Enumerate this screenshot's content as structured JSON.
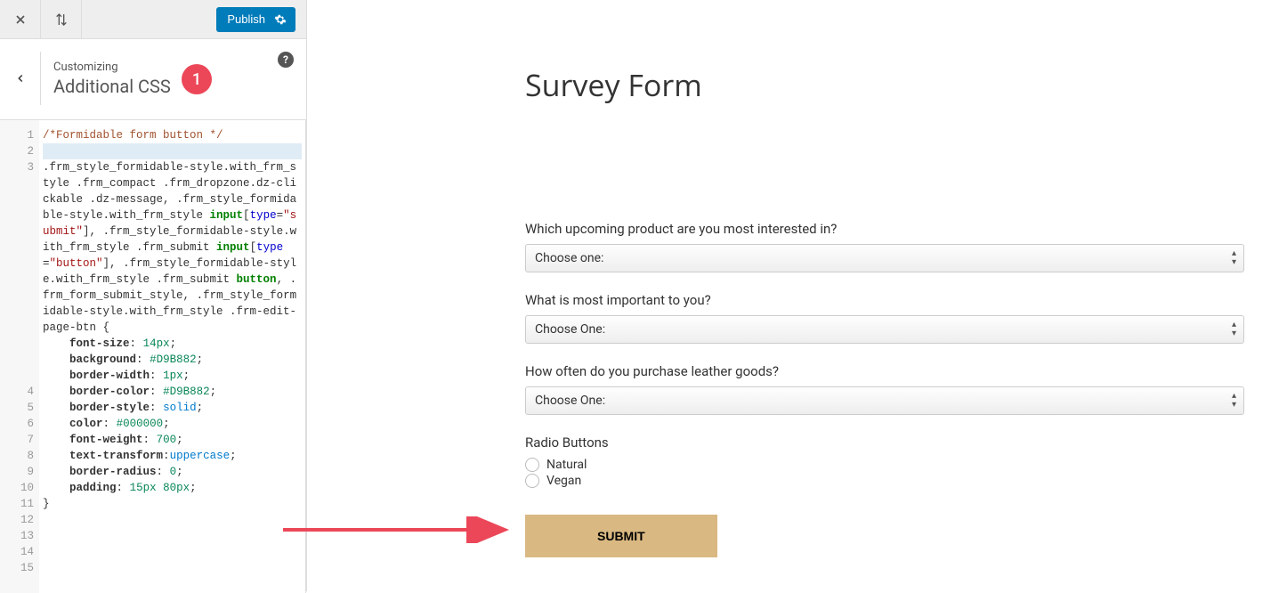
{
  "toolbar": {
    "publish_label": "Publish"
  },
  "panel": {
    "breadcrumb": "Customizing",
    "title": "Additional CSS"
  },
  "badge": "1",
  "preview": {
    "title": "Survey Form",
    "q1": {
      "label": "Which upcoming product are you most interested in?",
      "value": "Choose one:"
    },
    "q2": {
      "label": "What is most important to you?",
      "value": "Choose One:"
    },
    "q3": {
      "label": "How often do you purchase leather goods?",
      "value": "Choose One:"
    },
    "radios": {
      "label": "Radio Buttons",
      "opts": [
        "Natural",
        "Vegan"
      ]
    },
    "submit": "Submit"
  },
  "code": {
    "lines": [
      {
        "n": 1,
        "h": "<span class='c-comment'>/*Formidable form button */</span>"
      },
      {
        "n": 2,
        "h": "",
        "active": true
      },
      {
        "n": 3,
        "h": "<span class='c-sel'>.frm_style_formidable-style.with_frm_style .frm_compact .frm_dropzone.dz-clickable .dz-message</span><span class='c-punc'>,</span> <span class='c-sel'>.frm_style_formidable-style.with_frm_style </span><span class='c-kw'>input</span><span class='c-punc'>[</span><span class='c-attr'>type</span><span class='c-punc'>=</span><span class='c-str'>\"submit\"</span><span class='c-punc'>],</span> <span class='c-sel'>.frm_style_formidable-style.with_frm_style .frm_submit </span><span class='c-kw'>input</span><span class='c-punc'>[</span><span class='c-attr'>type</span><span class='c-punc'>=</span><span class='c-str'>\"button\"</span><span class='c-punc'>],</span> <span class='c-sel'>.frm_style_formidable-style.with_frm_style .frm_submit </span><span class='c-kw'>button</span><span class='c-punc'>,</span> <span class='c-sel'>.frm_form_submit_style</span><span class='c-punc'>,</span> <span class='c-sel'>.frm_style_formidable-style.with_frm_style .frm-edit-page-btn</span> <span class='c-punc'>{</span>",
        "wrap": true
      },
      {
        "n": 4,
        "h": "    <span class='c-prop'>font-size</span><span class='c-punc'>:</span> <span class='c-num'>14px</span><span class='c-punc'>;</span>"
      },
      {
        "n": 5,
        "h": "    <span class='c-prop'>background</span><span class='c-punc'>:</span> <span class='c-num'>#D9B882</span><span class='c-punc'>;</span>"
      },
      {
        "n": 6,
        "h": "    <span class='c-prop'>border-width</span><span class='c-punc'>:</span> <span class='c-num'>1px</span><span class='c-punc'>;</span>"
      },
      {
        "n": 7,
        "h": "    <span class='c-prop'>border-color</span><span class='c-punc'>:</span> <span class='c-num'>#D9B882</span><span class='c-punc'>;</span>"
      },
      {
        "n": 8,
        "h": "    <span class='c-prop'>border-style</span><span class='c-punc'>:</span> <span class='c-ident'>solid</span><span class='c-punc'>;</span>"
      },
      {
        "n": 9,
        "h": "    <span class='c-prop'>color</span><span class='c-punc'>:</span> <span class='c-num'>#000000</span><span class='c-punc'>;</span>"
      },
      {
        "n": 10,
        "h": "    <span class='c-prop'>font-weight</span><span class='c-punc'>:</span> <span class='c-num'>700</span><span class='c-punc'>;</span>"
      },
      {
        "n": 11,
        "h": "    <span class='c-prop'>text-transform</span><span class='c-punc'>:</span><span class='c-ident'>uppercase</span><span class='c-punc'>;</span>"
      },
      {
        "n": 12,
        "h": "    <span class='c-prop'>border-radius</span><span class='c-punc'>:</span> <span class='c-num'>0</span><span class='c-punc'>;</span>"
      },
      {
        "n": 13,
        "h": "    <span class='c-prop'>padding</span><span class='c-punc'>:</span> <span class='c-num'>15px</span> <span class='c-num'>80px</span><span class='c-punc'>;</span>"
      },
      {
        "n": 14,
        "h": "<span class='c-punc'>}</span>"
      },
      {
        "n": 15,
        "h": ""
      }
    ]
  }
}
